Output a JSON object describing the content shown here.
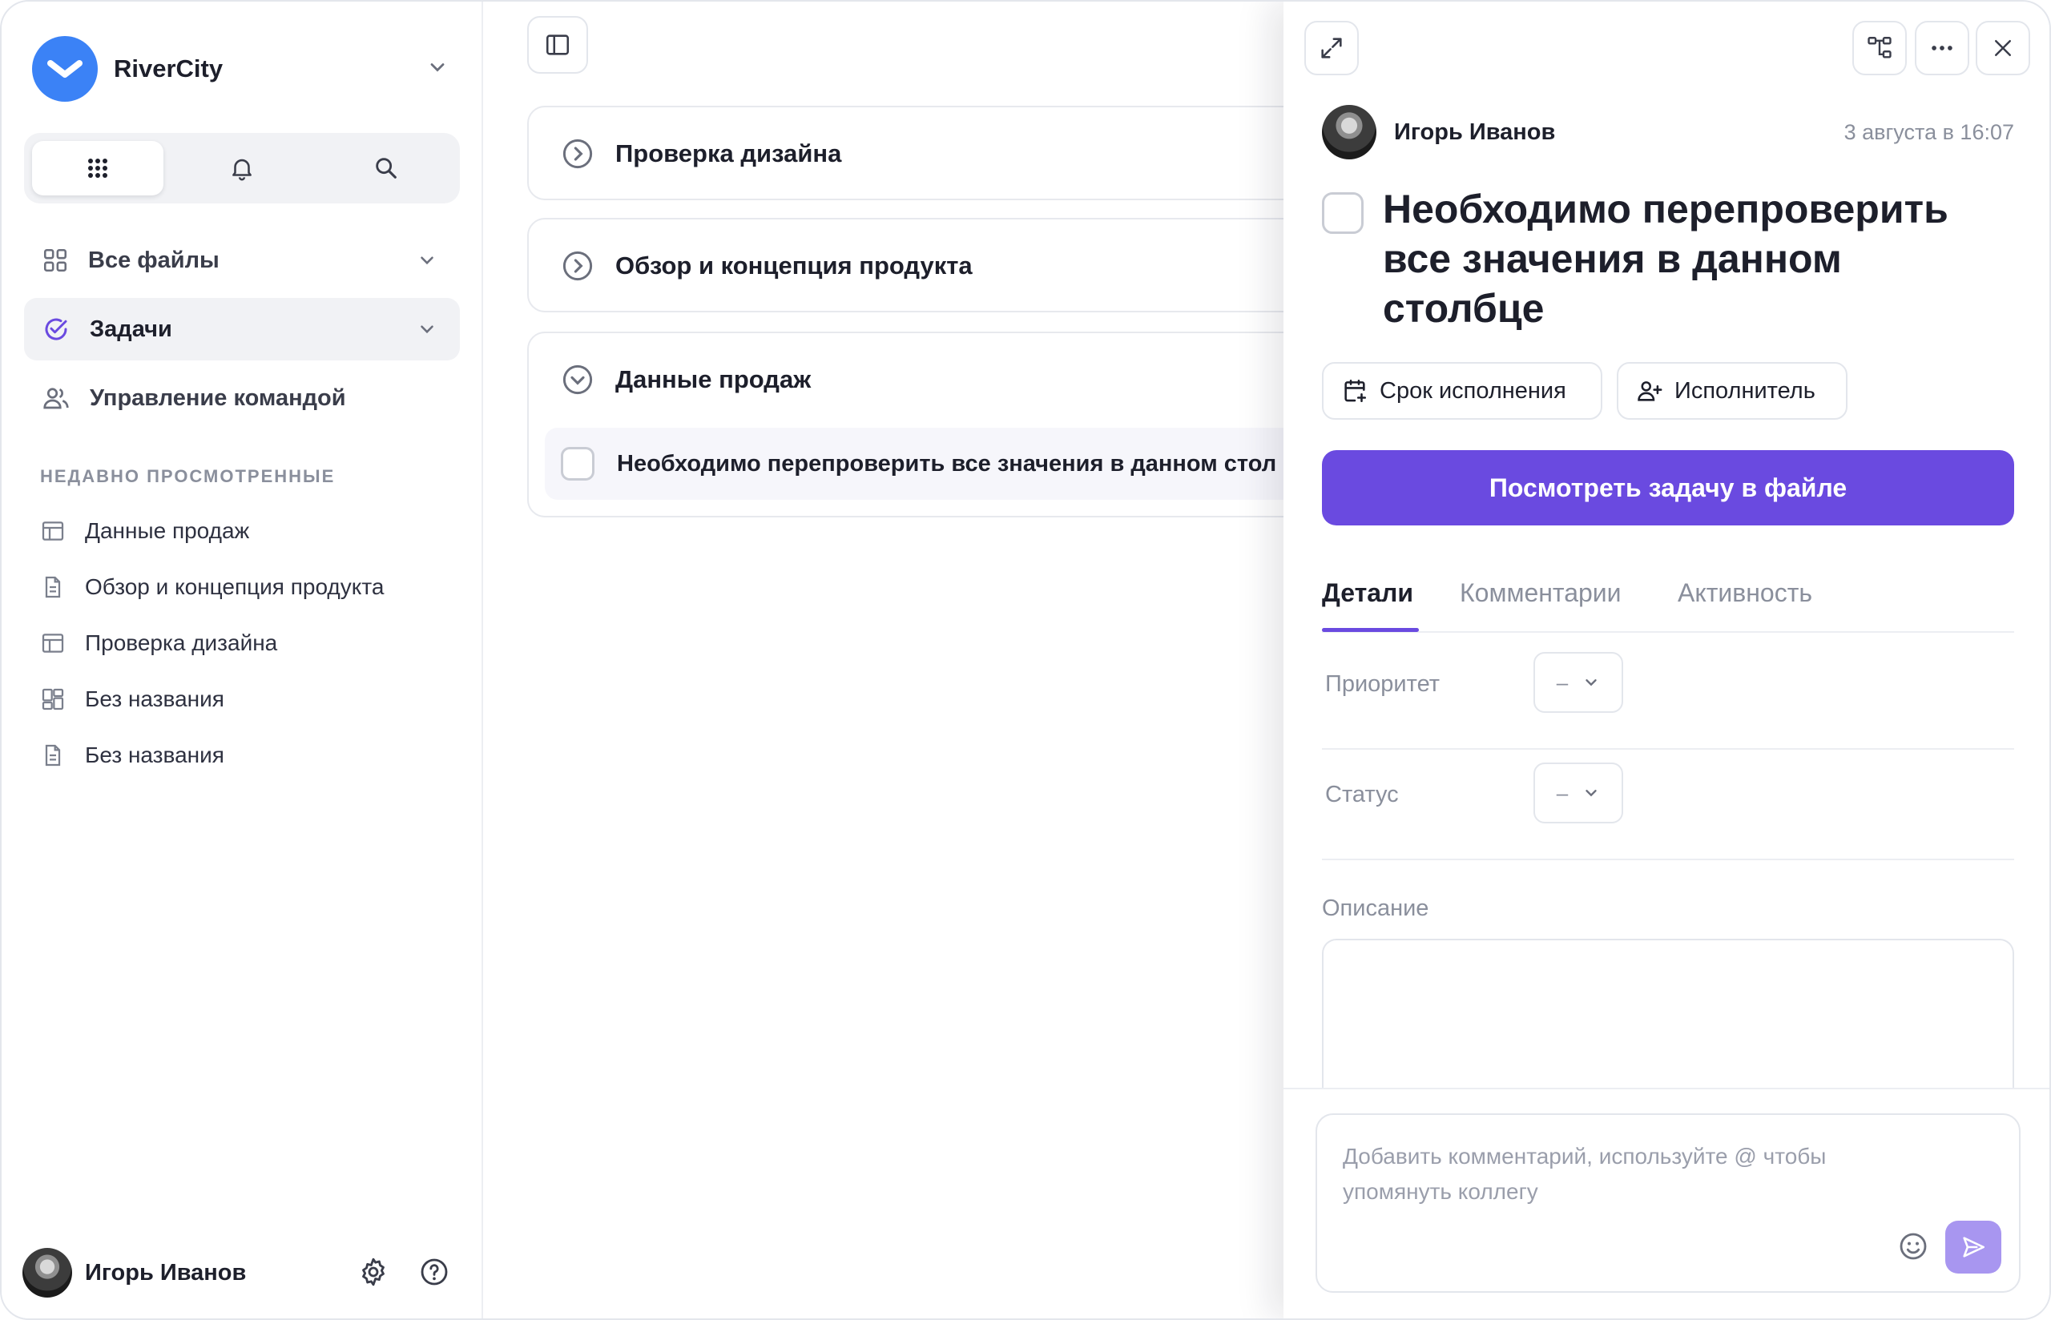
{
  "workspace": {
    "name": "RiverCity"
  },
  "sidebar": {
    "nav": [
      {
        "label": "Все файлы"
      },
      {
        "label": "Задачи"
      },
      {
        "label": "Управление командой"
      }
    ],
    "recent_heading": "НЕДАВНО ПРОСМОТРЕННЫЕ",
    "recent": [
      {
        "label": "Данные продаж",
        "icon": "table-icon"
      },
      {
        "label": "Обзор и концепция продукта",
        "icon": "document-icon"
      },
      {
        "label": "Проверка дизайна",
        "icon": "table-icon"
      },
      {
        "label": "Без названия",
        "icon": "dashboard-icon"
      },
      {
        "label": "Без названия",
        "icon": "document-icon"
      }
    ],
    "user": {
      "name": "Игорь Иванов"
    }
  },
  "main": {
    "groups": [
      {
        "label": "Проверка дизайна",
        "expanded": false
      },
      {
        "label": "Обзор и концепция продукта",
        "expanded": false
      },
      {
        "label": "Данные продаж",
        "expanded": true,
        "tasks": [
          {
            "label": "Необходимо перепроверить все значения в данном стол"
          }
        ]
      }
    ]
  },
  "panel": {
    "author": {
      "name": "Игорь Иванов",
      "time": "3 августа в 16:07"
    },
    "title": "Необходимо перепроверить все значения в данном столбце",
    "chips": {
      "due": "Срок исполнения",
      "assignee": "Исполнитель"
    },
    "primary_button": "Посмотреть задачу в файле",
    "tabs": [
      {
        "label": "Детали"
      },
      {
        "label": "Комментарии"
      },
      {
        "label": "Активность"
      }
    ],
    "fields": [
      {
        "label": "Приоритет",
        "value": "–"
      },
      {
        "label": "Статус",
        "value": "–"
      }
    ],
    "description_label": "Описание",
    "comment_placeholder": "Добавить комментарий, используйте @ чтобы упомянуть коллегу"
  },
  "colors": {
    "accent": "#6a4ae0",
    "brand": "#3b82f6",
    "send": "#a896f0"
  }
}
